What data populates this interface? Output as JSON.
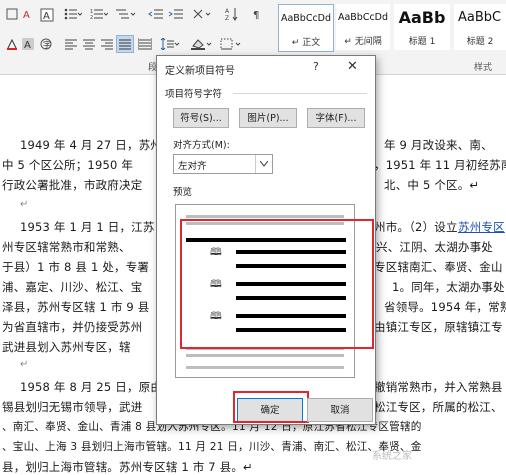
{
  "ribbon": {
    "paragraph_group_label": "段",
    "styles_group_label": "样式",
    "styles": [
      {
        "sample": "AaBbCcDd",
        "name": "↵ 正文"
      },
      {
        "sample": "AaBbCcDd",
        "name": "↵ 无间隔"
      },
      {
        "sample": "AaBb",
        "name": "标题 1"
      },
      {
        "sample": "AaBbC",
        "name": "标题 2"
      }
    ]
  },
  "document": {
    "p1": [
      "1949 年 4 月 27 日，苏州",
      "年 9 月改设来、南、",
      "中 5 个区公所；1950 年",
      "，1951 年 11 月初经苏南",
      "行政公署批准，市政府决定",
      "北、中 5 个区。↵"
    ],
    "p1_blank": "↵",
    "p2": [
      "1953 年 1 月 1 日，江苏",
      "州市。（2）设立",
      "苏州专区",
      "州专区辖常熟市和常熟、",
      "兴、江阴、太湖办事处",
      "于县）1 市 8 县 1 处，专署",
      "专区辖南汇、奉贤、金山",
      "浦、嘉定、川沙、松江、宝",
      "1。同年，太湖办事处",
      "泽县，苏州专区辖 1 市 9 县",
      "省领导。1954 年，常熟",
      "为省直辖市，并仍接受苏州",
      "由镇江专区，原辖镇江专",
      "武进县划入苏州专区，辖"
    ],
    "p2_blank": "↵",
    "p3": [
      "1958 年 8 月 25 日，原由",
      "撤销常熟市，并入常熟县",
      "锡县划归无锡市领导，武进",
      "松江专区，所属的松江、",
      "、南汇、奉贤、金山、青浦 8 县划入苏州专区。11 月 12 日，原江苏省松江专区管辖的",
      "、宝山、上海 3 县划归上海市管辖。11 月 21 日，川沙、青浦、南汇、松江、奉贤、金",
      "县，划归上海市管辖。苏州专区辖 1 市 7 县。↵"
    ]
  },
  "dialog": {
    "title": "定义新项目符号",
    "help": "?",
    "close": "✕",
    "group_char_label": "项目符号字符",
    "symbol_button": "符号(S)...",
    "picture_button": "图片(P)...",
    "font_button": "字体(F)...",
    "alignment_label": "对齐方式(M):",
    "alignment_value": "左对齐",
    "preview_label": "预览",
    "bullet_glyph": "🕮",
    "ok_button": "确定",
    "cancel_button": "取消"
  },
  "watermark": "系统之家",
  "colors": {
    "highlight": "#e0262e",
    "link": "#1f4fb8"
  }
}
